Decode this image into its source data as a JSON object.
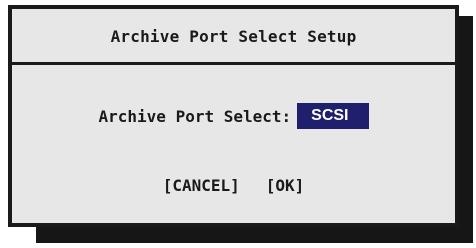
{
  "dialog": {
    "title": "Archive Port Select Setup",
    "field_label": "Archive Port Select:",
    "field_value": "SCSI",
    "cancel_label": "[CANCEL]",
    "ok_label": "[OK]"
  },
  "colors": {
    "dialog_background": "#e7e7e7",
    "border": "#1a1a1a",
    "shadow": "#161616",
    "selection_highlight": "#1f1f6e",
    "selection_text": "#ffffff"
  }
}
